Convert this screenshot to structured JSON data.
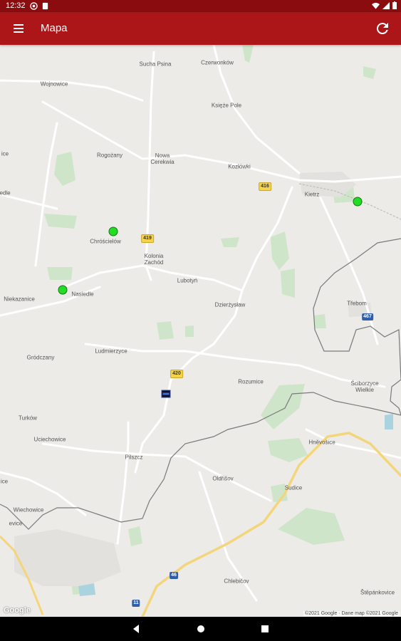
{
  "status_bar": {
    "time": "12:32",
    "icons": [
      "notification-a-icon",
      "notification-b-icon",
      "wifi-icon",
      "signal-icon",
      "battery-icon"
    ]
  },
  "app_bar": {
    "title": "Mapa",
    "color": "#ad1618",
    "menu_icon": "hamburger-menu-icon",
    "refresh_icon": "refresh-icon"
  },
  "map": {
    "places": {
      "sucha_psina": "Sucha Psina",
      "czerwonkow": "Czerwonków",
      "wojnowice": "Wojnowice",
      "ksieze_pole": "Księże Pole",
      "rogozany": "Rogożany",
      "nowa_cerekwia": "Nowa\nCerekwia",
      "kozlowki": "Kozłówki",
      "kietrz": "Kietrz",
      "chroscielow": "Chróścielów",
      "kolonia_zachod": "Kolonia\nZachód",
      "lubotyn": "Lubotyń",
      "niekazanice": "Niekazanice",
      "nasiedle": "Nasiedle",
      "dzierzyslaw": "Dzierżysław",
      "trebom": "Třebom",
      "grodczany": "Gródczany",
      "ludmierzyce": "Ludmierzyce",
      "rozumice": "Rozumice",
      "sciborzyce_wielkie": "Ściborzyce\nWielkie",
      "turkow": "Turków",
      "uciechowice": "Uciechowice",
      "pilszcz": "Pilszcz",
      "hnevosice": "Hněvošice",
      "oldrisov": "Oldřišov",
      "sudice": "Sudice",
      "wiechowice": "Wiechowice",
      "chlebicov": "Chlebičov",
      "stepankovice": "Štěpánkovice",
      "edge_left_a": "ice",
      "edge_left_b": "edle",
      "edge_left_c": "ice",
      "edge_left_d": "evice"
    },
    "road_shields": {
      "r416": "416",
      "r419": "419",
      "r420": "420",
      "r467": "467",
      "r46": "46",
      "r11": "11"
    },
    "markers": [
      {
        "name": "station-kietrz",
        "color": "#22dd22"
      },
      {
        "name": "station-chroscielow",
        "color": "#22dd22"
      },
      {
        "name": "station-nasiedle",
        "color": "#22dd22"
      }
    ],
    "vehicle_label": "vehicle-icon",
    "google_logo": "Google",
    "attribution": "©2021 Google · Dane map ©2021 Google"
  },
  "nav_bar": {
    "icons": [
      "back-icon",
      "home-icon",
      "recents-icon"
    ]
  }
}
